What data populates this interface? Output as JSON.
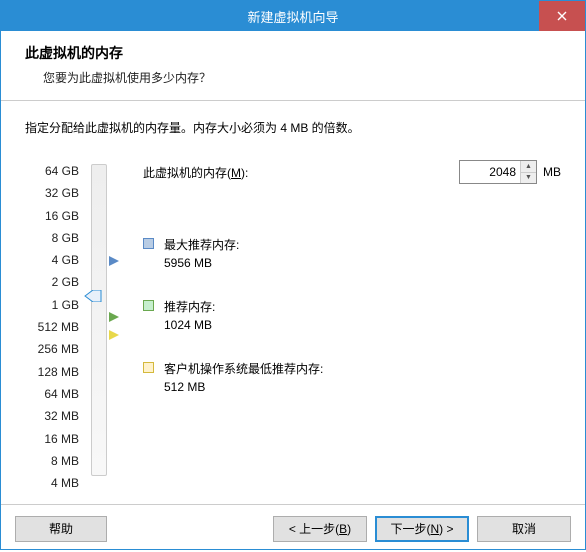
{
  "window": {
    "title": "新建虚拟机向导"
  },
  "header": {
    "title": "此虚拟机的内存",
    "subtitle": "您要为此虚拟机使用多少内存？"
  },
  "content": {
    "desc": "指定分配给此虚拟机的内存量。内存大小必须为 4 MB 的倍数。",
    "mem_label_prefix": "此虚拟机的内存(",
    "mem_label_key": "M",
    "mem_label_suffix": "):",
    "mem_value": "2048",
    "mem_unit": "MB"
  },
  "slider_labels": [
    "64 GB",
    "32 GB",
    "16 GB",
    "8 GB",
    "4 GB",
    "2 GB",
    "1 GB",
    "512 MB",
    "256 MB",
    "128 MB",
    "64 MB",
    "32 MB",
    "16 MB",
    "8 MB",
    "4 MB"
  ],
  "recs": {
    "max": {
      "label": "最大推荐内存:",
      "value": "5956 MB"
    },
    "rec": {
      "label": "推荐内存:",
      "value": "1024 MB"
    },
    "min": {
      "label": "客户机操作系统最低推荐内存:",
      "value": "512 MB"
    }
  },
  "footer": {
    "help": "帮助",
    "back_prefix": "< 上一步(",
    "back_key": "B",
    "back_suffix": ")",
    "next_prefix": "下一步(",
    "next_key": "N",
    "next_suffix": ") >",
    "cancel": "取消"
  }
}
